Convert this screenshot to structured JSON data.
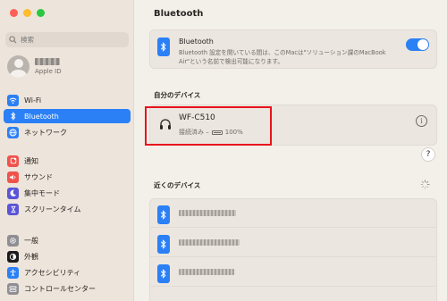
{
  "window": {
    "controls": [
      "close",
      "minimize",
      "zoom"
    ]
  },
  "search": {
    "placeholder": "検索"
  },
  "account": {
    "subtitle": "Apple ID"
  },
  "sidebar": {
    "items": [
      {
        "label": "Wi-Fi",
        "icon": "wifi-icon",
        "color": "#2b80f6"
      },
      {
        "label": "Bluetooth",
        "icon": "bluetooth-icon",
        "color": "#2b80f6",
        "active": true
      },
      {
        "label": "ネットワーク",
        "icon": "globe-icon",
        "color": "#2b80f6"
      },
      {
        "label": "通知",
        "icon": "bell-icon",
        "color": "#f0524c"
      },
      {
        "label": "サウンド",
        "icon": "speaker-icon",
        "color": "#f0524c"
      },
      {
        "label": "集中モード",
        "icon": "moon-icon",
        "color": "#5a55d6"
      },
      {
        "label": "スクリーンタイム",
        "icon": "hourglass-icon",
        "color": "#5a55d6"
      },
      {
        "label": "一般",
        "icon": "gear-icon",
        "color": "#8e8e93"
      },
      {
        "label": "外観",
        "icon": "appearance-icon",
        "color": "#1c1c1e"
      },
      {
        "label": "アクセシビリティ",
        "icon": "accessibility-icon",
        "color": "#2b80f6"
      },
      {
        "label": "コントロールセンター",
        "icon": "control-center-icon",
        "color": "#8e8e93"
      }
    ]
  },
  "main": {
    "title": "Bluetooth",
    "bluetooth_card": {
      "title": "Bluetooth",
      "description": "Bluetooth 設定を開いている間は、このMacは\"ソリューション課のMacBook Air\"という名前で検出可能になります。",
      "enabled": true
    },
    "my_devices": {
      "heading": "自分のデバイス",
      "device": {
        "name": "WF-C510",
        "status": "接続済み –",
        "battery": "100%",
        "icon": "headphones-icon"
      }
    },
    "help_label": "?",
    "nearby": {
      "heading": "近くのデバイス",
      "rows": [
        {
          "icon": "bluetooth-icon"
        },
        {
          "icon": "bluetooth-icon"
        },
        {
          "icon": "bluetooth-icon"
        }
      ]
    }
  },
  "colors": {
    "accent": "#2b80f6",
    "highlight": "#e8141c"
  }
}
